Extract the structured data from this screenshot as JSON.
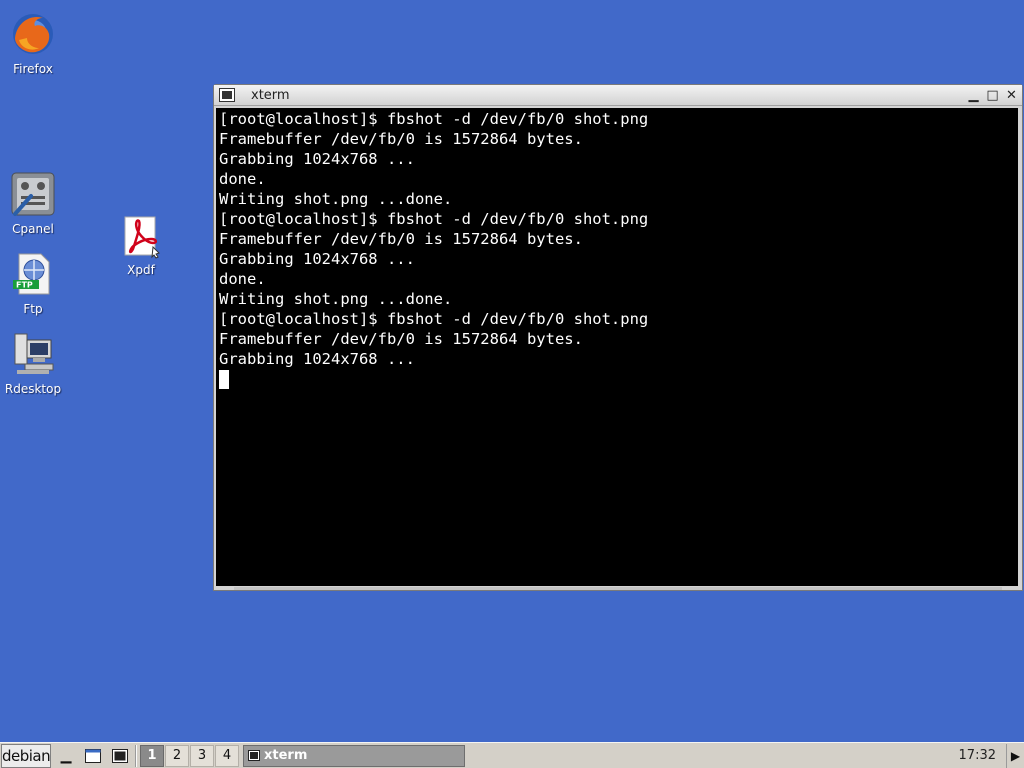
{
  "desktop": {
    "icons": [
      {
        "label": "Firefox",
        "icon": "firefox-icon"
      },
      {
        "label": "Cpanel",
        "icon": "control-panel-icon"
      },
      {
        "label": "Xpdf",
        "icon": "pdf-icon"
      },
      {
        "label": "Ftp",
        "icon": "ftp-icon"
      },
      {
        "label": "Rdesktop",
        "icon": "remote-desktop-icon"
      }
    ]
  },
  "xterm": {
    "title": "xterm",
    "lines": [
      "[root@localhost]$ fbshot -d /dev/fb/0 shot.png",
      "Framebuffer /dev/fb/0 is 1572864 bytes.",
      "Grabbing 1024x768 ...",
      "done.",
      "Writing shot.png ...done.",
      "[root@localhost]$ fbshot -d /dev/fb/0 shot.png",
      "Framebuffer /dev/fb/0 is 1572864 bytes.",
      "Grabbing 1024x768 ...",
      "done.",
      "Writing shot.png ...done.",
      "[root@localhost]$ fbshot -d /dev/fb/0 shot.png",
      "Framebuffer /dev/fb/0 is 1572864 bytes.",
      "Grabbing 1024x768 ..."
    ]
  },
  "taskbar": {
    "start_label": "debian",
    "pages": [
      "1",
      "2",
      "3",
      "4"
    ],
    "active_page": "1",
    "task_label": "xterm",
    "clock": "17:32"
  },
  "colors": {
    "desktop_bg": "#4169c9",
    "terminal_bg": "#000000",
    "terminal_fg": "#ffffff",
    "taskbar_bg": "#d4d0c8"
  }
}
